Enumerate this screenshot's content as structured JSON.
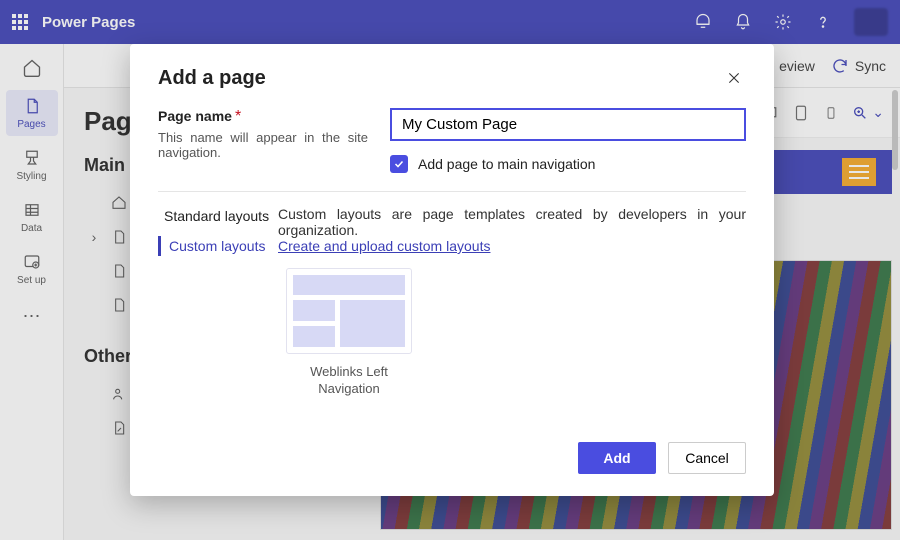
{
  "topbar": {
    "brand": "Power Pages"
  },
  "cmdbar": {
    "preview": "eview",
    "sync": "Sync"
  },
  "rail": {
    "home": "",
    "items": [
      {
        "label": "Pages"
      },
      {
        "label": "Styling"
      },
      {
        "label": "Data"
      },
      {
        "label": "Set up"
      }
    ]
  },
  "page": {
    "title": "Page",
    "section_main": "Main",
    "section_other": "Other"
  },
  "modal": {
    "title": "Add a page",
    "page_name_label": "Page name",
    "page_name_help": "This name will appear in the site navigation.",
    "page_name_value": "My Custom Page",
    "add_to_nav": "Add page to main navigation",
    "tab_standard": "Standard layouts",
    "tab_custom": "Custom layouts",
    "desc": "Custom layouts are page templates created by developers in your organization.",
    "link": "Create and upload custom layouts",
    "cards": [
      {
        "label": "Weblinks Left Navigation"
      }
    ],
    "add": "Add",
    "cancel": "Cancel"
  }
}
